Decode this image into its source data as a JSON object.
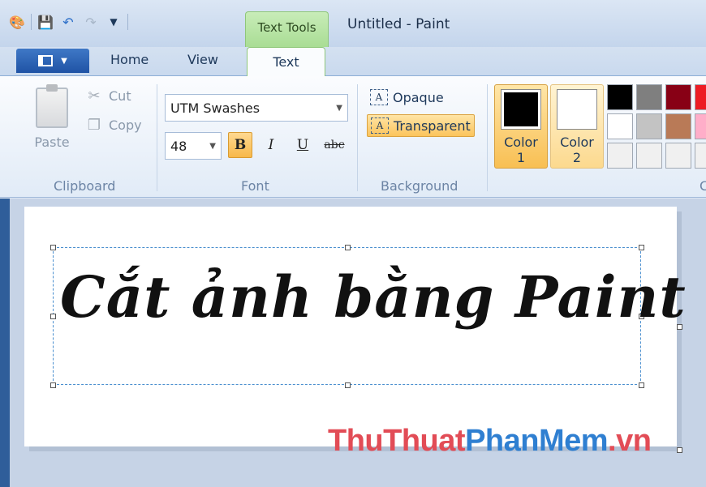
{
  "window": {
    "title": "Untitled - Paint",
    "contextual_tab": "Text Tools"
  },
  "tabs": [
    "Home",
    "View",
    "Text"
  ],
  "active_tab": "Text",
  "ribbon": {
    "clipboard": {
      "paste": "Paste",
      "cut": "Cut",
      "copy": "Copy",
      "group": "Clipboard"
    },
    "font": {
      "family": "UTM Swashes",
      "size": "48",
      "group": "Font",
      "bold": "B",
      "italic": "I",
      "underline": "U",
      "strike": "abc"
    },
    "background": {
      "opaque": "Opaque",
      "transparent": "Transparent",
      "group": "Background"
    },
    "colors": {
      "color1_line1": "Color",
      "color1_line2": "1",
      "color2_line1": "Color",
      "color2_line2": "2",
      "color1": "#000000",
      "color2": "#ffffff"
    },
    "palette": [
      "#000000",
      "#7f7f7f",
      "#880015",
      "#ed1c24",
      "#ffffff",
      "#c3c3c3",
      "#b97a57",
      "#ffaec9",
      "#f0f0f0",
      "#f0f0f0",
      "#f0f0f0",
      "#f0f0f0"
    ],
    "group_cut": "C"
  },
  "canvas": {
    "text": "Cắt ảnh bằng Paint"
  },
  "watermark": {
    "part1": "ThuThuat",
    "part2": "PhanMem",
    "part3": ".vn"
  }
}
